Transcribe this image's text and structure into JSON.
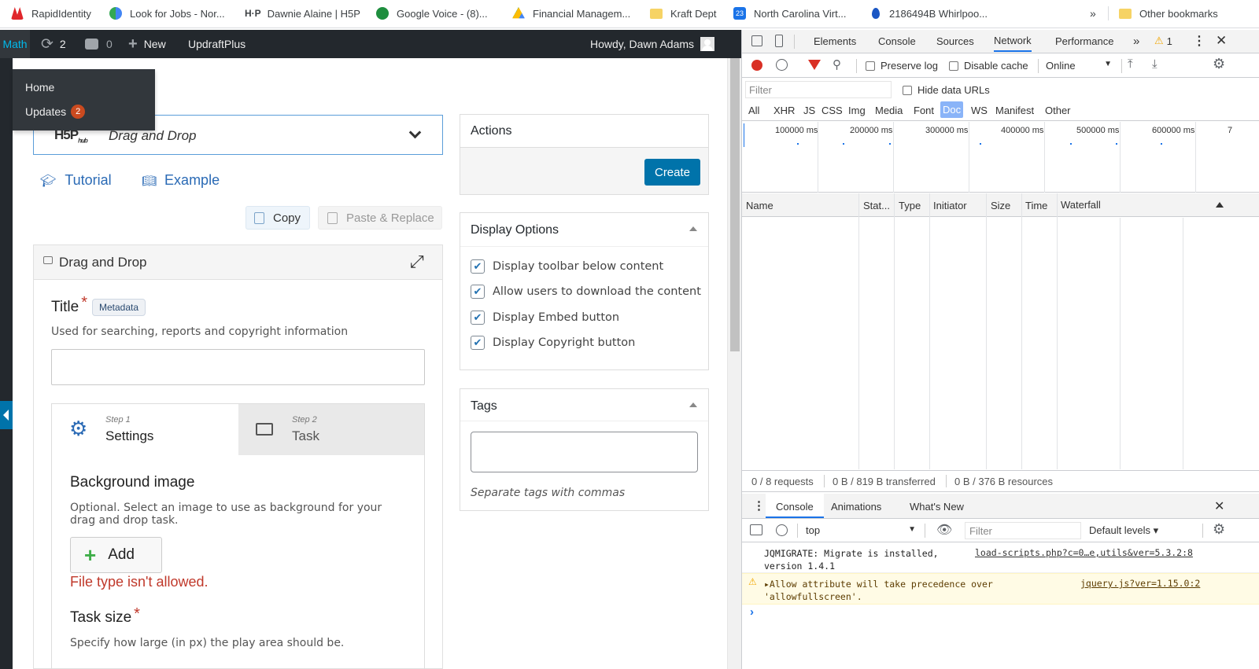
{
  "bookmarks": {
    "items": [
      {
        "label": "RapidIdentity",
        "icon": "rapididentity-icon",
        "color": "#e0262b"
      },
      {
        "label": "Look for Jobs - Nor...",
        "icon": "globe-icon",
        "color": "#34a853"
      },
      {
        "label": "Dawnie Alaine | H5P",
        "icon": "h5p-icon",
        "color": "#111111"
      },
      {
        "label": "Google Voice - (8)...",
        "icon": "phone-icon",
        "color": "#1e8e3e"
      },
      {
        "label": "Financial Managem...",
        "icon": "drive-icon",
        "color": "#fbbc04"
      },
      {
        "label": "Kraft Dept",
        "icon": "folder-icon",
        "color": "#f6d365"
      },
      {
        "label": "North Carolina Virt...",
        "icon": "calendar-icon",
        "color": "#1a73e8"
      },
      {
        "label": "2186494B Whirlpoo...",
        "icon": "drop-icon",
        "color": "#1a56c4"
      }
    ],
    "overflow": "»",
    "other_label": "Other bookmarks"
  },
  "adminbar": {
    "site": "Math",
    "updates_count": "2",
    "comments_count": "0",
    "new_label": "New",
    "updraft_label": "UpdraftPlus",
    "howdy": "Howdy, Dawn Adams"
  },
  "dropdown": {
    "home": "Home",
    "updates": "Updates",
    "updates_badge": "2"
  },
  "editor": {
    "hub_logo": "H5P",
    "hub_sub": "hub",
    "content_type": "Drag and Drop",
    "tutorial": "Tutorial",
    "example": "Example",
    "copy": "Copy",
    "paste_replace": "Paste & Replace",
    "section_title": "Drag and Drop",
    "title_label": "Title",
    "metadata": "Metadata",
    "title_desc": "Used for searching, reports and copyright information",
    "title_value": "",
    "step1_small": "Step 1",
    "step1": "Settings",
    "step2_small": "Step 2",
    "step2": "Task",
    "bg_label": "Background image",
    "bg_desc": "Optional. Select an image to use as background for your drag and drop task.",
    "add": "Add",
    "error": "File type isn't allowed.",
    "task_size_label": "Task size",
    "task_size_desc": "Specify how large (in px) the play area should be."
  },
  "actions": {
    "title": "Actions",
    "create": "Create"
  },
  "display_options": {
    "title": "Display Options",
    "items": [
      "Display toolbar below content",
      "Allow users to download the content",
      "Display Embed button",
      "Display Copyright button"
    ]
  },
  "tags": {
    "title": "Tags",
    "value": "",
    "hint": "Separate tags with commas"
  },
  "devtools": {
    "tabs": [
      "Elements",
      "Console",
      "Sources",
      "Network",
      "Performance"
    ],
    "active_tab": "Network",
    "more": "»",
    "warn_count": "1",
    "preserve_log": "Preserve log",
    "disable_cache": "Disable cache",
    "throttle": "Online",
    "filter_placeholder": "Filter",
    "hide_data_urls": "Hide data URLs",
    "types": [
      "All",
      "XHR",
      "JS",
      "CSS",
      "Img",
      "Media",
      "Font",
      "Doc",
      "WS",
      "Manifest",
      "Other"
    ],
    "active_type": "Doc",
    "timeline": [
      "100000 ms",
      "200000 ms",
      "300000 ms",
      "400000 ms",
      "500000 ms",
      "600000 ms",
      "7"
    ],
    "columns": [
      "Name",
      "Stat...",
      "Type",
      "Initiator",
      "Size",
      "Time",
      "Waterfall"
    ],
    "summary": {
      "requests": "0 / 8 requests",
      "transferred": "0 B / 819 B transferred",
      "resources": "0 B / 376 B resources"
    },
    "drawer_tabs": [
      "Console",
      "Animations",
      "What's New"
    ],
    "context": "top",
    "console_filter": "Filter",
    "levels": "Default levels ▾",
    "messages": [
      {
        "text": "JQMIGRATE: Migrate is installed, version 1.4.1",
        "source": "load-scripts.php?c=0…e,utils&ver=5.3.2:8",
        "level": "info"
      },
      {
        "text": "▸Allow attribute will take precedence over 'allowfullscreen'.",
        "source": "jquery.js?ver=1.15.0:2",
        "level": "warning"
      }
    ],
    "prompt": "›"
  }
}
